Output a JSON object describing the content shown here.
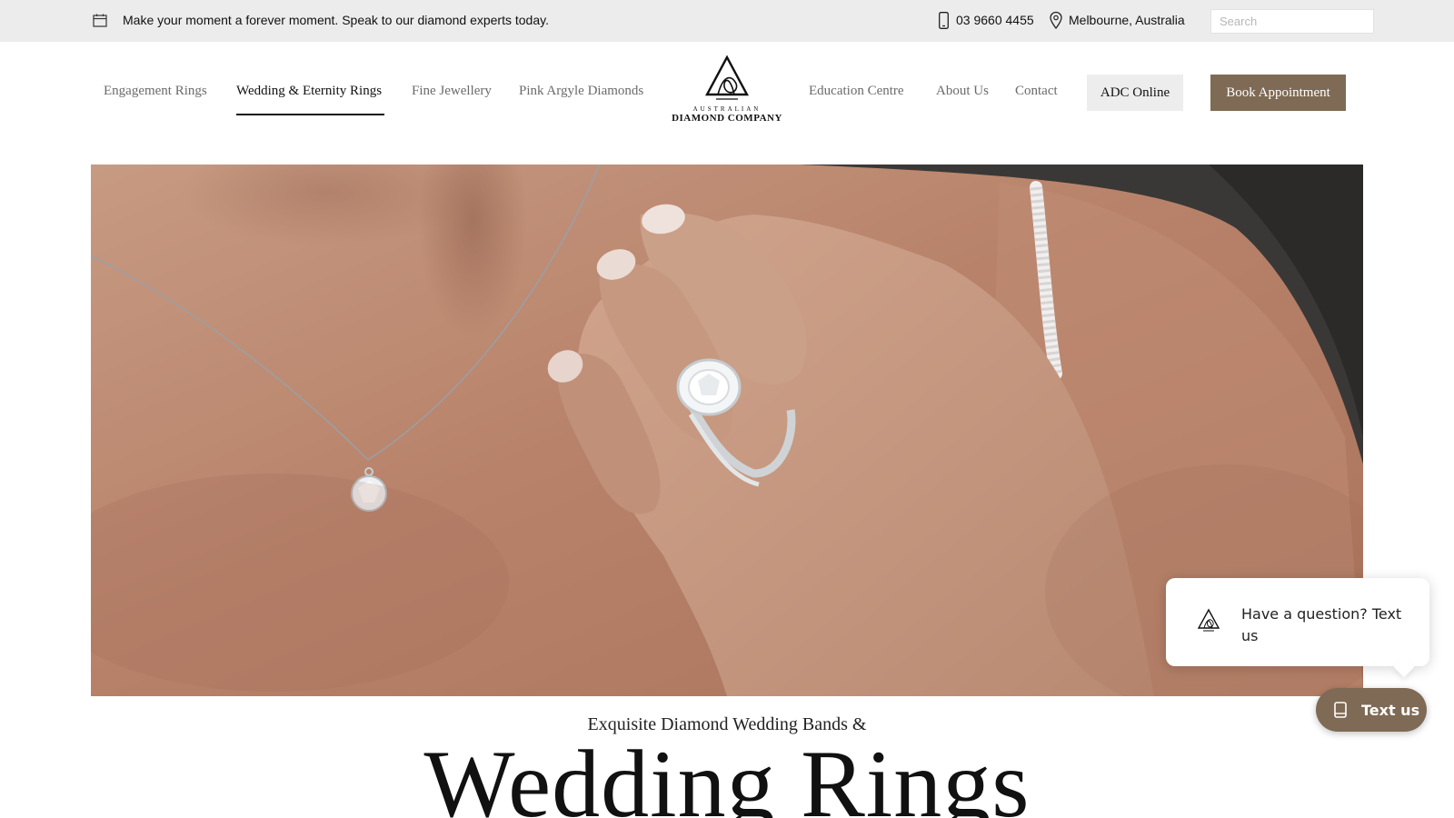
{
  "topbar": {
    "promo_text": "Make your moment a forever moment. Speak to our diamond experts today.",
    "phone": "03 9660 4455",
    "location": "Melbourne, Australia",
    "search_placeholder": "Search",
    "icons": [
      "calendar-icon",
      "phone-icon",
      "map-pin-icon"
    ]
  },
  "nav": {
    "left_items": [
      {
        "label": "Engagement Rings"
      },
      {
        "label": "Wedding & Eternity Rings",
        "active": true
      },
      {
        "label": "Fine Jewellery"
      },
      {
        "label": "Pink Argyle Diamonds"
      }
    ],
    "right_items": [
      {
        "label": "Education Centre"
      },
      {
        "label": "About Us"
      },
      {
        "label": "Contact"
      }
    ],
    "online_button": "ADC Online",
    "book_button": "Book Appointment"
  },
  "logo": {
    "line1": "AUSTRALIAN",
    "line2": "DIAMOND COMPANY"
  },
  "hero": {
    "subheading": "Exquisite Diamond Wedding Bands &",
    "heading": "Wedding Rings"
  },
  "chat": {
    "bubble_text": "Have a question? Text us",
    "button_label": "Text us"
  },
  "colors": {
    "brand_brown": "#7e6a55",
    "topbar_bg": "#ececec",
    "button_grey": "#ededed"
  }
}
